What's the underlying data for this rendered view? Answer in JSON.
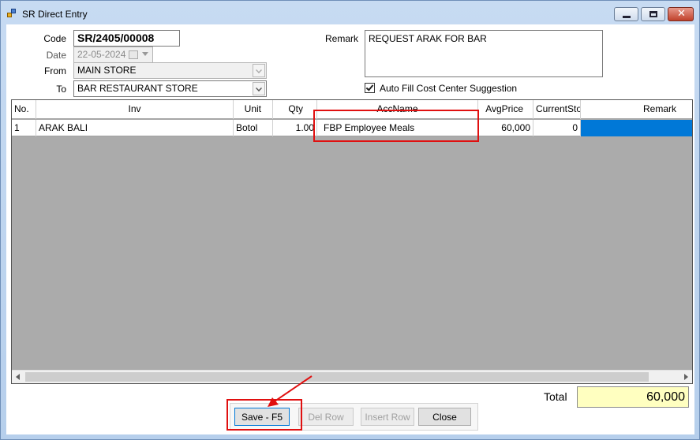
{
  "window": {
    "title": "SR Direct Entry"
  },
  "form": {
    "code_label": "Code",
    "code_value": "SR/2405/00008",
    "date_label": "Date",
    "date_value": "22-05-2024",
    "from_label": "From",
    "from_value": "MAIN STORE",
    "to_label": "To",
    "to_value": "BAR RESTAURANT STORE",
    "remark_label": "Remark",
    "remark_value": "REQUEST ARAK FOR BAR",
    "autofill_label": "Auto Fill Cost Center Suggestion"
  },
  "grid": {
    "headers": [
      "No.",
      "Inv",
      "Unit",
      "Qty",
      "AccName",
      "AvgPrice",
      "CurrentStock",
      "Remark"
    ],
    "rows": [
      {
        "no": "1",
        "inv": "ARAK BALI",
        "unit": "Botol",
        "qty": "1.00",
        "accname": "FBP Employee Meals",
        "avgprice": "60,000",
        "currentstock": "0",
        "remark": ""
      }
    ]
  },
  "footer": {
    "total_label": "Total",
    "total_value": "60,000",
    "save_label": "Save - F5",
    "delrow_label": "Del Row",
    "insertrow_label": "Insert Row",
    "close_label": "Close"
  },
  "colors": {
    "selection": "#0078d7",
    "total_bg": "#ffffc0",
    "annotation": "#e01010"
  }
}
